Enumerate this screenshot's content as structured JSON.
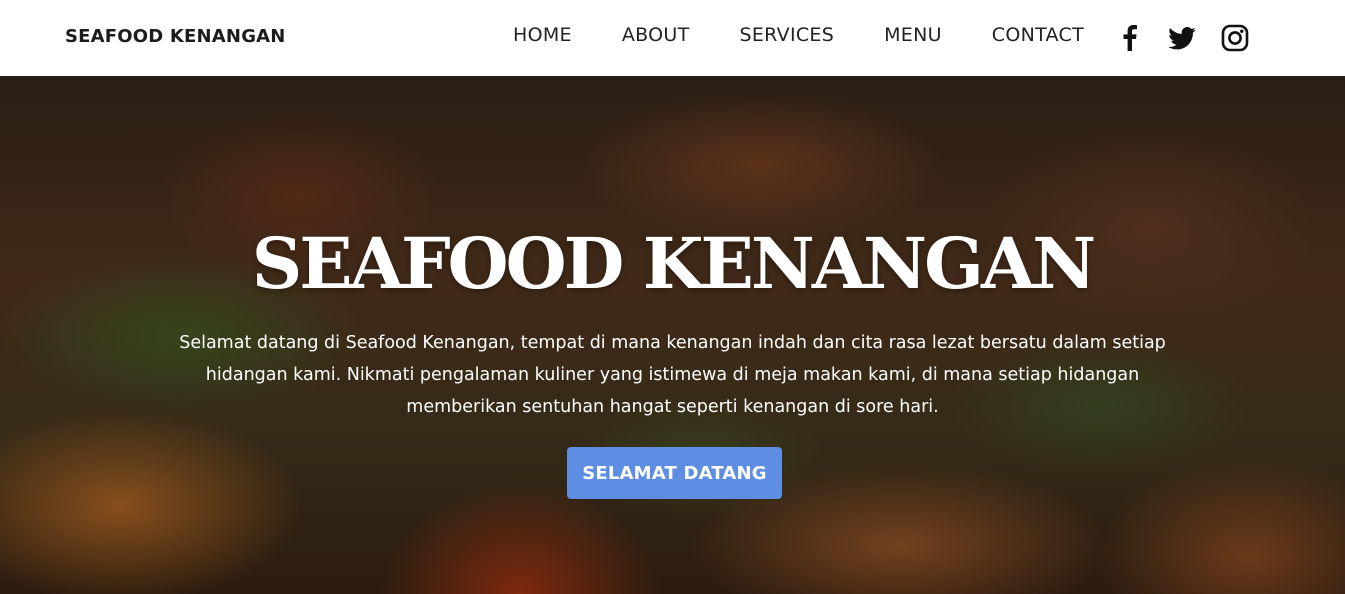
{
  "nav": {
    "brand": "SEAFOOD KENANGAN",
    "links": [
      {
        "label": "HOME"
      },
      {
        "label": "ABOUT"
      },
      {
        "label": "SERVICES"
      },
      {
        "label": "MENU"
      },
      {
        "label": "CONTACT"
      }
    ],
    "social": [
      {
        "icon": "facebook-icon"
      },
      {
        "icon": "twitter-icon"
      },
      {
        "icon": "instagram-icon"
      }
    ]
  },
  "hero": {
    "title": "SEAFOOD KENANGAN",
    "text": "Selamat datang di Seafood Kenangan, tempat di mana kenangan indah dan cita rasa lezat bersatu dalam setiap hidangan kami. Nikmati pengalaman kuliner yang istimewa di meja makan kami, di mana setiap hidangan memberikan sentuhan hangat seperti kenangan di sore hari.",
    "button_label": "SELAMAT DATANG"
  },
  "colors": {
    "navbar_bg": "#ffffff",
    "nav_text": "#222222",
    "hero_text": "#ffffff",
    "button_bg": "#5e8ee4"
  }
}
